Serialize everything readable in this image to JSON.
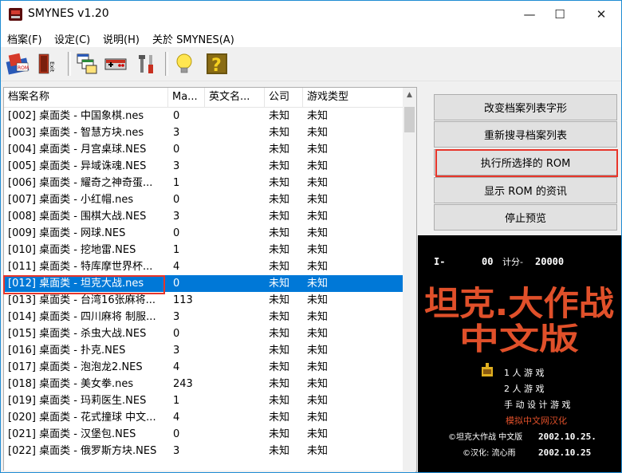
{
  "window": {
    "title": "SMYNES v1.20",
    "minimize_glyph": "—",
    "maximize_glyph": "☐",
    "close_glyph": "✕"
  },
  "menu": {
    "items": [
      "档案(F)",
      "设定(C)",
      "说明(H)",
      "关於 SMYNES(A)"
    ]
  },
  "toolbar": {
    "icons": [
      "rom-open-icon",
      "exit-icon",
      "windows-icon",
      "gamepad-icon",
      "tools-icon",
      "lightbulb-icon",
      "help-icon"
    ],
    "exit_label": "Exit",
    "rom_label": "ROM"
  },
  "list": {
    "columns": [
      "档案名称",
      "Ma...",
      "英文名...",
      "公司",
      "游戏类型"
    ],
    "rows": [
      {
        "name": "[002]  桌面类 - 中国象棋.nes",
        "ma": "0",
        "en": "",
        "company": "未知",
        "type": "未知"
      },
      {
        "name": "[003]  桌面类 - 智慧方块.nes",
        "ma": "3",
        "en": "",
        "company": "未知",
        "type": "未知"
      },
      {
        "name": "[004]  桌面类 - 月宫桌球.NES",
        "ma": "0",
        "en": "",
        "company": "未知",
        "type": "未知"
      },
      {
        "name": "[005]  桌面类 - 异域诛魂.NES",
        "ma": "3",
        "en": "",
        "company": "未知",
        "type": "未知"
      },
      {
        "name": "[006]  桌面类 - 耀奇之神奇蛋...",
        "ma": "1",
        "en": "",
        "company": "未知",
        "type": "未知"
      },
      {
        "name": "[007]  桌面类 - 小红帽.nes",
        "ma": "0",
        "en": "",
        "company": "未知",
        "type": "未知"
      },
      {
        "name": "[008]  桌面类 - 围棋大战.NES",
        "ma": "3",
        "en": "",
        "company": "未知",
        "type": "未知"
      },
      {
        "name": "[009]  桌面类 - 网球.NES",
        "ma": "0",
        "en": "",
        "company": "未知",
        "type": "未知"
      },
      {
        "name": "[010]  桌面类 - 挖地雷.NES",
        "ma": "1",
        "en": "",
        "company": "未知",
        "type": "未知"
      },
      {
        "name": "[011]  桌面类 - 特库摩世界杯...",
        "ma": "4",
        "en": "",
        "company": "未知",
        "type": "未知"
      },
      {
        "name": "[012]  桌面类 - 坦克大战.nes",
        "ma": "0",
        "en": "",
        "company": "未知",
        "type": "未知",
        "selected": true
      },
      {
        "name": "[013]  桌面类 - 台湾16张麻将...",
        "ma": "113",
        "en": "",
        "company": "未知",
        "type": "未知"
      },
      {
        "name": "[014]  桌面类 - 四川麻将 制服...",
        "ma": "3",
        "en": "",
        "company": "未知",
        "type": "未知"
      },
      {
        "name": "[015]  桌面类 - 杀虫大战.NES",
        "ma": "0",
        "en": "",
        "company": "未知",
        "type": "未知"
      },
      {
        "name": "[016]  桌面类 - 扑克.NES",
        "ma": "3",
        "en": "",
        "company": "未知",
        "type": "未知"
      },
      {
        "name": "[017]  桌面类 - 泡泡龙2.NES",
        "ma": "4",
        "en": "",
        "company": "未知",
        "type": "未知"
      },
      {
        "name": "[018]  桌面类 - 美女拳.nes",
        "ma": "243",
        "en": "",
        "company": "未知",
        "type": "未知"
      },
      {
        "name": "[019]  桌面类 - 玛莉医生.NES",
        "ma": "1",
        "en": "",
        "company": "未知",
        "type": "未知"
      },
      {
        "name": "[020]  桌面类 - 花式撞球 中文...",
        "ma": "4",
        "en": "",
        "company": "未知",
        "type": "未知"
      },
      {
        "name": "[021]  桌面类 - 汉堡包.NES",
        "ma": "0",
        "en": "",
        "company": "未知",
        "type": "未知"
      },
      {
        "name": "[022]  桌面类 - 俄罗斯方块.NES",
        "ma": "3",
        "en": "",
        "company": "未知",
        "type": "未知"
      }
    ]
  },
  "buttons": {
    "change_font": "改变档案列表字形",
    "rescan": "重新搜寻档案列表",
    "run_rom": "执行所选择的 ROM",
    "show_info": "显示 ROM 的资讯",
    "stop_preview": "停止预览"
  },
  "preview": {
    "hud_player": "I-",
    "hud_score": "00",
    "hud_label": "计分-",
    "hud_hiscore": "20000",
    "logo_line1": "坦克.大作战",
    "logo_line2": "中文版",
    "menu_1": "1 人 游 戏",
    "menu_2": "2 人 游 戏",
    "menu_3": "手 动 设 计 游 戏",
    "credit_group": "模拟中文网汉化",
    "copyright_1_left": "©坦克大作战 中文版",
    "copyright_1_date": "2002.10.25.",
    "copyright_2_left": "©汉化: 流心雨",
    "copyright_2_date": "2002.10.25",
    "colors": {
      "logo": "#e0502a",
      "credit": "#e0502a",
      "text": "#ffffff",
      "tank": "#e0b020"
    }
  },
  "colors": {
    "selection": "#0078d7",
    "highlight_border": "#e8352a",
    "window_border": "#1f8cd3"
  }
}
